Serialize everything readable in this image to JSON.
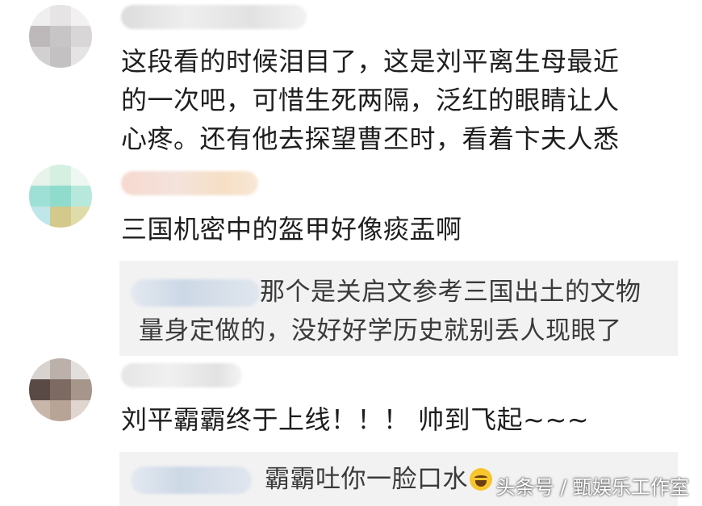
{
  "comments": [
    {
      "text": "这段看的时候泪目了，这是刘平离生母最近\n的一次吧，可惜生死两隔，泛红的眼睛让人\n心疼。还有他去探望曹丕时，看着卞夫人悉"
    },
    {
      "text": "三国机密中的盔甲好像痰盂啊",
      "reply": "那个是关启文参考三国出土的文物\n量身定做的，没好好学历史就别丢人现眼了"
    },
    {
      "text": "刘平霸霸终于上线！！！ 帅到飞起~~~",
      "reply": "霸霸吐你一脸口水"
    }
  ],
  "watermark": "头条号 / 甄娱乐工作室",
  "colors": {
    "text": "#1e1e1e",
    "reply_bg": "#f2f2f2",
    "reply_text": "#3a3a3a"
  },
  "icons": {
    "reply_emoji": "laughing-tears-emoji-icon"
  }
}
